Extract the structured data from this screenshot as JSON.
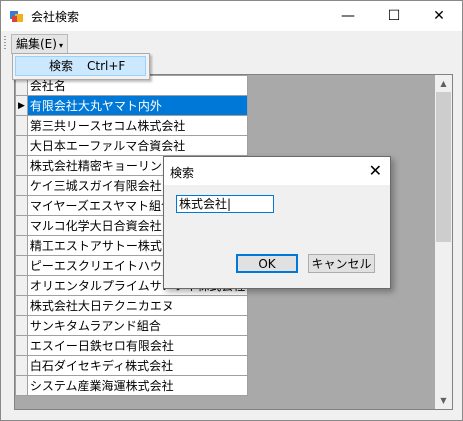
{
  "window": {
    "title": "会社検索",
    "minimize_glyph": "—",
    "maximize_glyph": "☐",
    "close_glyph": "✕"
  },
  "menu": {
    "edit_label": "編集(E)",
    "edit_arrow": "▾",
    "search_item_label": "検索",
    "search_item_shortcut": "Ctrl+F"
  },
  "grid": {
    "column_header": "会社名",
    "selected_row_marker": "▶",
    "rows": [
      "有限会社大丸ヤマト内外",
      "第三共リースセコム株式会社",
      "大日本エーファルマ合資会社",
      "株式会社精密キョーリン",
      "ケイ三城スガイ有限会社",
      "マイヤーズエスヤマト組合",
      "マルコ化学大日合資会社",
      "精工エストアサトー株式会社",
      "ピーエスクリエイトハウス",
      "オリエンタルプライムサノフィ株式会社",
      "株式会社大日テクニカエヌ",
      "サンキタムラアンド組合",
      "エスイー日鉄セロ有限会社",
      "白石ダイセキディ株式会社",
      "システム産業海運株式会社"
    ]
  },
  "dialog": {
    "title": "検索",
    "close_glyph": "✕",
    "input_value": "株式会社|",
    "ok_label": "OK",
    "cancel_label": "キャンセル"
  },
  "colors": {
    "selection": "#0078d7",
    "focus_border": "#0078d7",
    "menu_highlight": "#cce8ff"
  }
}
